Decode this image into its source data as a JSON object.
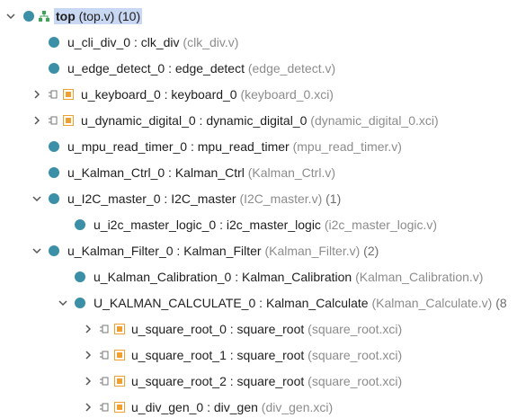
{
  "tree": {
    "top": {
      "name": "top",
      "file": "(top.v)",
      "count": "(10)"
    },
    "rows": [
      {
        "instance": "u_cli_div_0",
        "module": "clk_div",
        "file": "(clk_div.v)",
        "count": ""
      },
      {
        "instance": "u_edge_detect_0",
        "module": "edge_detect",
        "file": "(edge_detect.v)",
        "count": ""
      },
      {
        "instance": "u_keyboard_0",
        "module": "keyboard_0",
        "file": "(keyboard_0.xci)",
        "count": ""
      },
      {
        "instance": "u_dynamic_digital_0",
        "module": "dynamic_digital_0",
        "file": "(dynamic_digital_0.xci)",
        "count": ""
      },
      {
        "instance": "u_mpu_read_timer_0",
        "module": "mpu_read_timer",
        "file": "(mpu_read_timer.v)",
        "count": ""
      },
      {
        "instance": "u_Kalman_Ctrl_0",
        "module": "Kalman_Ctrl",
        "file": "(Kalman_Ctrl.v)",
        "count": ""
      },
      {
        "instance": "u_I2C_master_0",
        "module": "I2C_master",
        "file": "(I2C_master.v)",
        "count": "(1)"
      },
      {
        "instance": "u_i2c_master_logic_0",
        "module": "i2c_master_logic",
        "file": "(i2c_master_logic.v)",
        "count": ""
      },
      {
        "instance": "u_Kalman_Filter_0",
        "module": "Kalman_Filter",
        "file": "(Kalman_Filter.v)",
        "count": "(2)"
      },
      {
        "instance": "u_Kalman_Calibration_0",
        "module": "Kalman_Calibration",
        "file": "(Kalman_Calibration.v)",
        "count": ""
      },
      {
        "instance": "U_KALMAN_CALCULATE_0",
        "module": "Kalman_Calculate",
        "file": "(Kalman_Calculate.v)",
        "count": "(8"
      },
      {
        "instance": "u_square_root_0",
        "module": "square_root",
        "file": "(square_root.xci)",
        "count": ""
      },
      {
        "instance": "u_square_root_1",
        "module": "square_root",
        "file": "(square_root.xci)",
        "count": ""
      },
      {
        "instance": "u_square_root_2",
        "module": "square_root",
        "file": "(square_root.xci)",
        "count": ""
      },
      {
        "instance": "u_div_gen_0",
        "module": "div_gen",
        "file": "(div_gen.xci)",
        "count": ""
      }
    ],
    "separator": " : "
  },
  "colors": {
    "module_dot": "#3b8fa6",
    "ip_orange": "#f0a030",
    "selection": "#c9d8f2",
    "file_text": "#8c8c8c",
    "hier_green": "#3aa655"
  },
  "icons": {
    "expand": "chevron-down-icon",
    "collapsed": "chevron-right-icon",
    "module": "module-dot-icon",
    "ip": "ip-core-icon",
    "connector": "connector-icon",
    "hierarchy": "hierarchy-icon"
  }
}
